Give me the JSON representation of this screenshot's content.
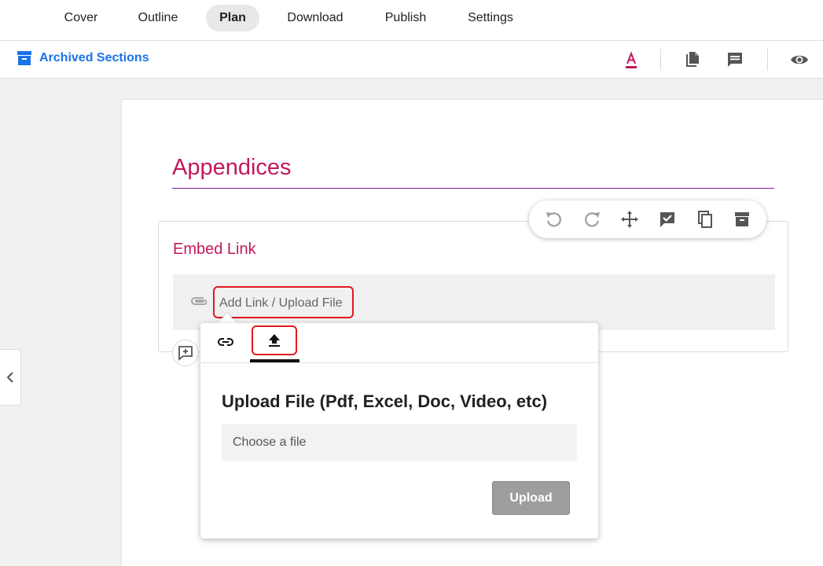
{
  "topnav": {
    "tabs": [
      {
        "label": "Cover"
      },
      {
        "label": "Outline"
      },
      {
        "label": "Plan",
        "active": true
      },
      {
        "label": "Download"
      },
      {
        "label": "Publish"
      },
      {
        "label": "Settings"
      }
    ]
  },
  "subbar": {
    "archived_label": "Archived Sections",
    "icons": [
      "text-color-icon",
      "document-icon",
      "comment-icon",
      "eye-icon"
    ]
  },
  "page": {
    "title": "Appendices",
    "section": {
      "title": "Embed Link",
      "add_link_label": "Add Link / Upload File"
    },
    "toolbar_icons": [
      "undo-icon",
      "redo-icon",
      "move-icon",
      "approve-icon",
      "copy-icon",
      "archive-icon"
    ]
  },
  "popover": {
    "tabs": [
      "link-icon",
      "upload-icon"
    ],
    "selected_tab": "upload-icon",
    "heading": "Upload File (Pdf, Excel, Doc, Video, etc)",
    "file_placeholder": "Choose a file",
    "upload_label": "Upload"
  },
  "colors": {
    "accent": "#c2185b",
    "link": "#1a73e8",
    "highlight": "#e0191e",
    "button_disabled": "#9e9e9e"
  }
}
